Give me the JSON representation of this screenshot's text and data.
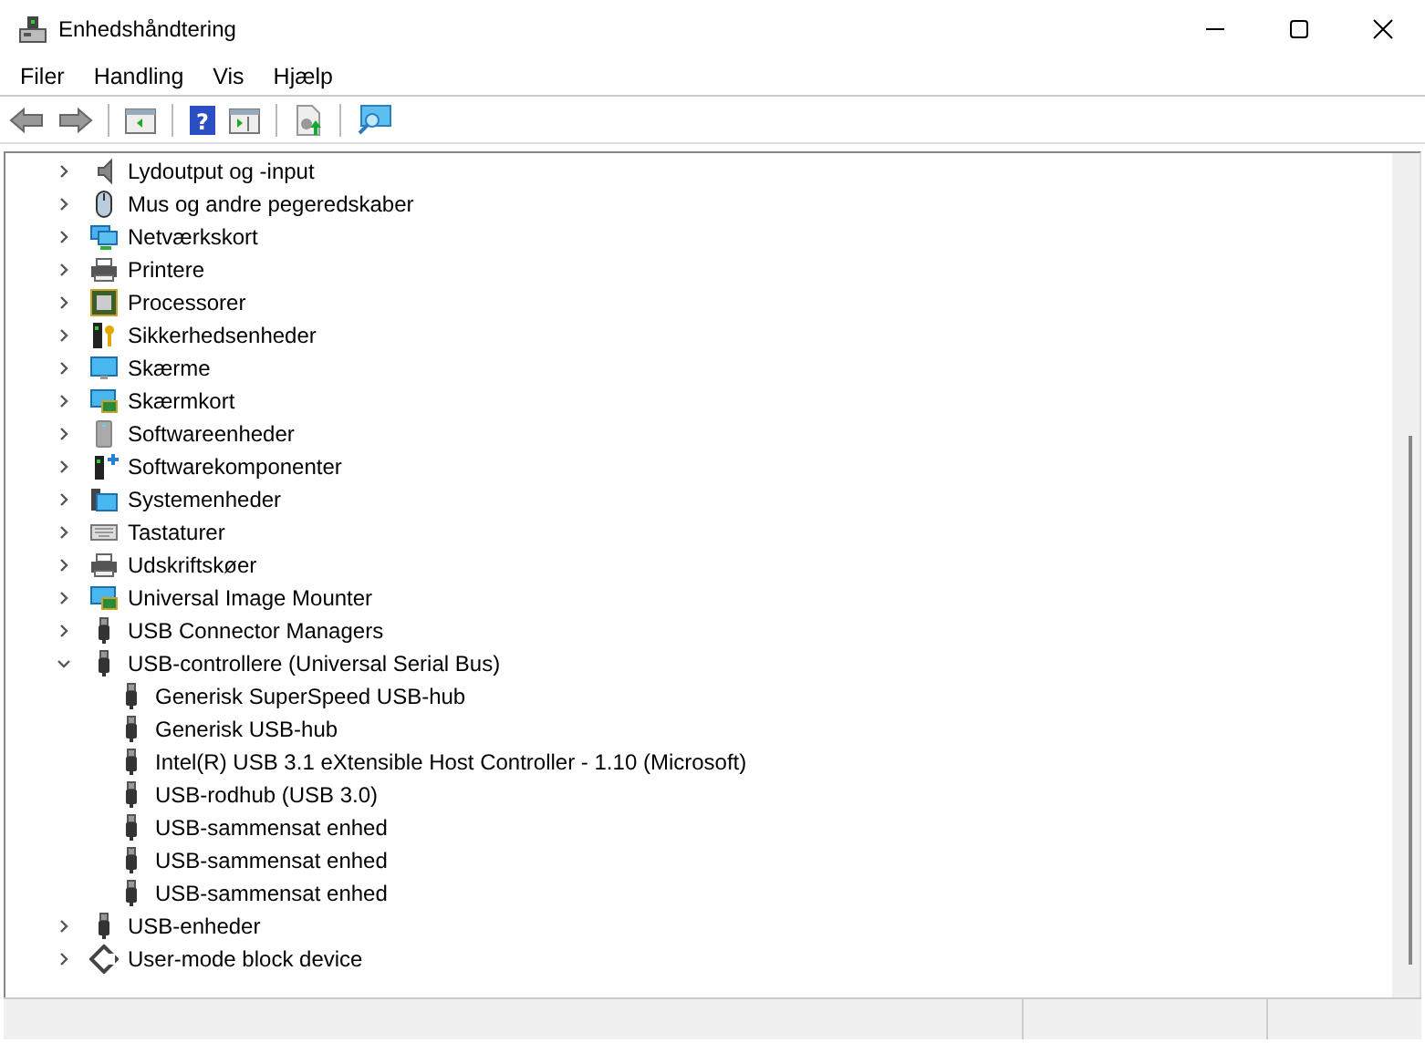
{
  "window": {
    "title": "Enhedshåndtering"
  },
  "menu": [
    "Filer",
    "Handling",
    "Vis",
    "Hjælp"
  ],
  "toolbar": {
    "help_glyph": "?"
  },
  "tree": [
    {
      "label": "Lydoutput og -input",
      "kind": "audio",
      "expanded": false
    },
    {
      "label": "Mus og andre pegeredskaber",
      "kind": "mouse",
      "expanded": false
    },
    {
      "label": "Netværkskort",
      "kind": "network",
      "expanded": false
    },
    {
      "label": "Printere",
      "kind": "printer",
      "expanded": false
    },
    {
      "label": "Processorer",
      "kind": "cpu",
      "expanded": false
    },
    {
      "label": "Sikkerhedsenheder",
      "kind": "security",
      "expanded": false
    },
    {
      "label": "Skærme",
      "kind": "monitor",
      "expanded": false
    },
    {
      "label": "Skærmkort",
      "kind": "display",
      "expanded": false
    },
    {
      "label": "Softwareenheder",
      "kind": "software",
      "expanded": false
    },
    {
      "label": "Softwarekomponenter",
      "kind": "component",
      "expanded": false
    },
    {
      "label": "Systemenheder",
      "kind": "system",
      "expanded": false
    },
    {
      "label": "Tastaturer",
      "kind": "keyboard",
      "expanded": false
    },
    {
      "label": "Udskriftskøer",
      "kind": "printer",
      "expanded": false
    },
    {
      "label": "Universal Image Mounter",
      "kind": "display",
      "expanded": false
    },
    {
      "label": "USB Connector Managers",
      "kind": "usb",
      "expanded": false
    },
    {
      "label": "USB-controllere (Universal Serial Bus)",
      "kind": "usb",
      "expanded": true,
      "children": [
        {
          "label": "Generisk SuperSpeed USB-hub",
          "kind": "usb"
        },
        {
          "label": "Generisk USB-hub",
          "kind": "usb"
        },
        {
          "label": "Intel(R) USB 3.1 eXtensible Host Controller - 1.10 (Microsoft)",
          "kind": "usb"
        },
        {
          "label": "USB-rodhub (USB 3.0)",
          "kind": "usb"
        },
        {
          "label": "USB-sammensat enhed",
          "kind": "usb"
        },
        {
          "label": "USB-sammensat enhed",
          "kind": "usb"
        },
        {
          "label": "USB-sammensat enhed",
          "kind": "usb"
        }
      ]
    },
    {
      "label": "USB-enheder",
      "kind": "usb",
      "expanded": false
    },
    {
      "label": "User-mode block device",
      "kind": "block",
      "expanded": false
    }
  ]
}
